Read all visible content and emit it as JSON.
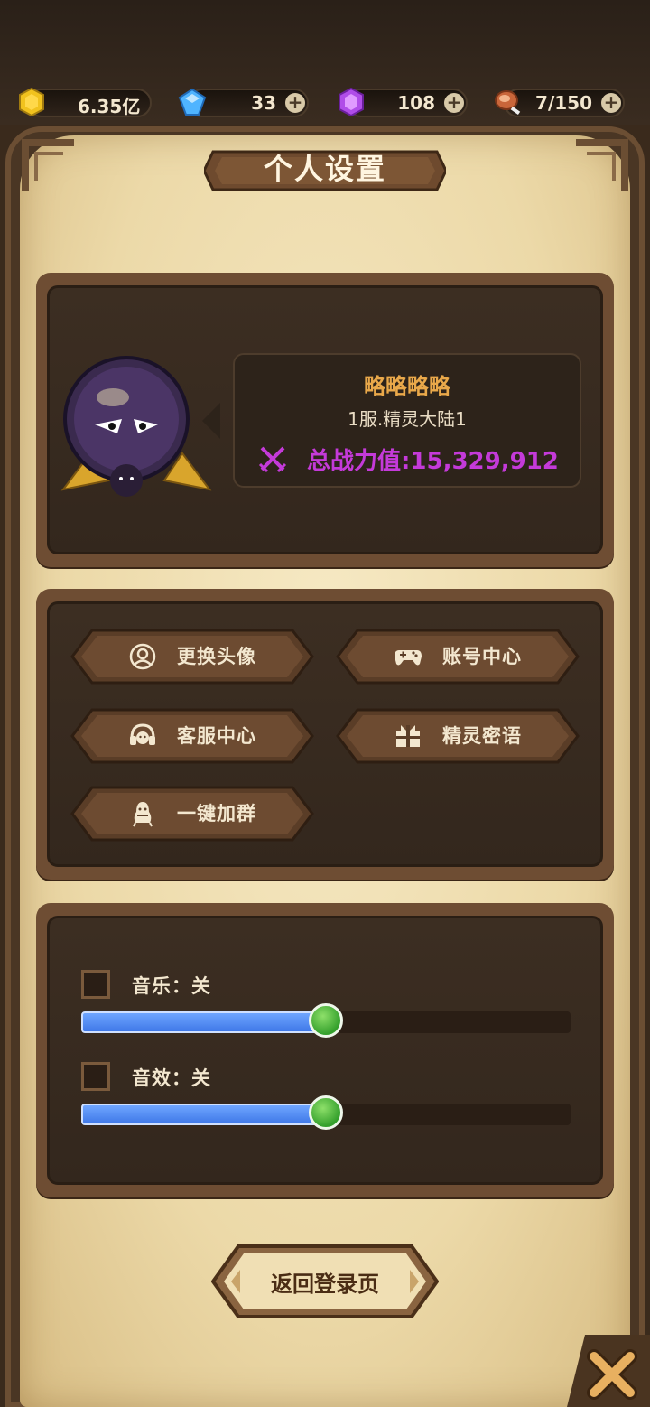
{
  "resources": {
    "gold": {
      "value": "6.35亿",
      "icon": "gold-coin-icon"
    },
    "gem": {
      "value": "33",
      "icon": "blue-diamond-icon"
    },
    "crystal": {
      "value": "108",
      "icon": "purple-crystal-icon"
    },
    "stamina": {
      "value": "7/150",
      "icon": "meat-icon"
    }
  },
  "page": {
    "title": "个人设置"
  },
  "profile": {
    "name": "略略略略",
    "server": "1服.精灵大陆1",
    "power_label": "总战力值:15,329,912"
  },
  "buttons": [
    {
      "label": "更换头像",
      "icon": "avatar-icon"
    },
    {
      "label": "账号中心",
      "icon": "gamepad-icon"
    },
    {
      "label": "客服中心",
      "icon": "headset-icon"
    },
    {
      "label": "精灵密语",
      "icon": "gift-code-icon"
    },
    {
      "label": "一键加群",
      "icon": "group-icon"
    }
  ],
  "settings": {
    "music": {
      "label": "音乐：关",
      "volume_fraction": 0.5,
      "checked": false
    },
    "sfx": {
      "label": "音效：关",
      "volume_fraction": 0.5,
      "checked": false
    }
  },
  "footer": {
    "return_label": "返回登录页"
  },
  "colors": {
    "accent_purple": "#c43ad9",
    "name_orange": "#e9a84a",
    "slider_blue": "#3f78e8",
    "knob_green": "#34a02c"
  }
}
